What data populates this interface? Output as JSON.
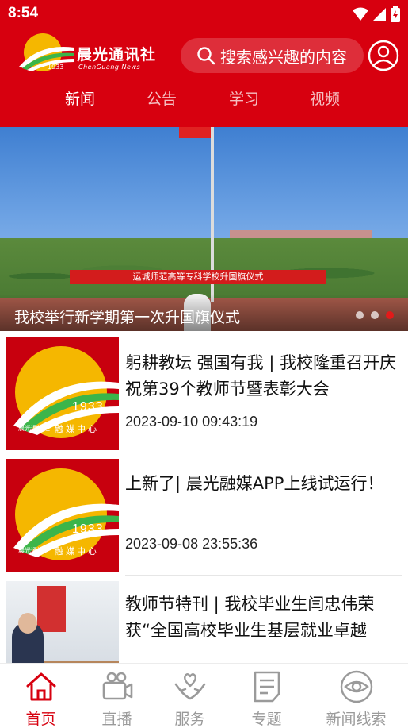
{
  "status_bar": {
    "time": "8:54"
  },
  "brand": {
    "name": "晨光通讯社",
    "subtitle": "ChenGuang News",
    "year": "1933"
  },
  "search": {
    "placeholder": "搜索感兴趣的内容"
  },
  "top_tabs": [
    {
      "label": "新闻",
      "active": true
    },
    {
      "label": "公告",
      "active": false
    },
    {
      "label": "学习",
      "active": false
    },
    {
      "label": "视频",
      "active": false
    }
  ],
  "banner": {
    "caption": "我校举行新学期第一次升国旗仪式",
    "slogan": "运城师范高等专科学校升国旗仪式",
    "slide_count": 3,
    "active_slide": 3
  },
  "news": [
    {
      "title": "躬耕教坛  强国有我 | 我校隆重召开庆祝第39个教师节暨表彰大会",
      "time": "2023-09-10 09:43:19",
      "thumb": {
        "year": "1933",
        "label": "晨光通讯社",
        "media": "融媒中心"
      }
    },
    {
      "title": "上新了| 晨光融媒APP上线试运行！",
      "time": "2023-09-08 23:55:36",
      "thumb": {
        "year": "1933",
        "label": "晨光通讯社",
        "media": "融媒中心"
      }
    },
    {
      "title": "教师节特刊 | 我校毕业生闫忠伟荣获“全国高校毕业生基层就业卓越",
      "time": ""
    }
  ],
  "bottom_nav": [
    {
      "label": "首页",
      "icon": "home-icon",
      "active": true
    },
    {
      "label": "直播",
      "icon": "live-camera-icon",
      "active": false
    },
    {
      "label": "服务",
      "icon": "service-hands-icon",
      "active": false
    },
    {
      "label": "专题",
      "icon": "topic-document-icon",
      "active": false
    },
    {
      "label": "新闻线索",
      "icon": "news-tip-eye-icon",
      "active": false
    }
  ],
  "colors": {
    "brand_red": "#d7000f",
    "nav_inactive": "#9a9a9a"
  }
}
